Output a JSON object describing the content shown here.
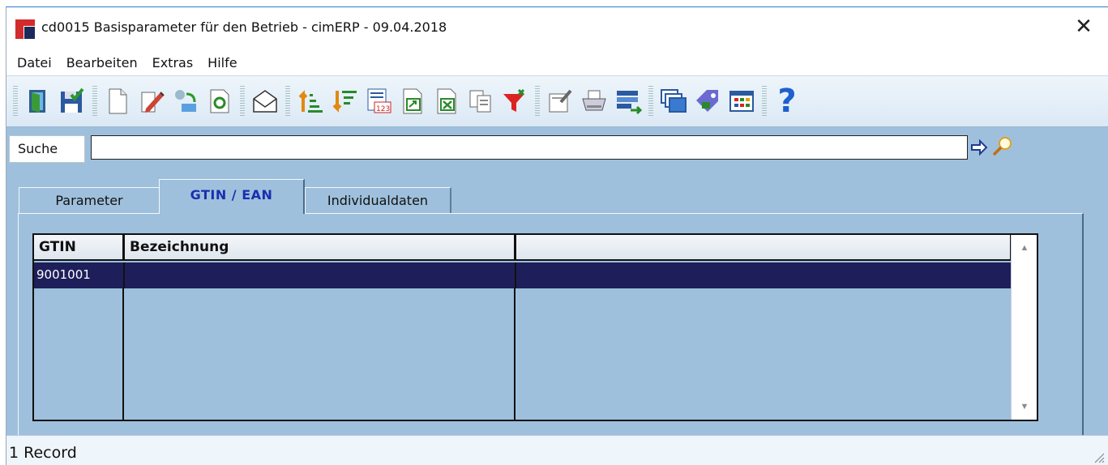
{
  "window": {
    "title": "cd0015 Basisparameter für den Betrieb - cimERP - 09.04.2018",
    "close_glyph": "✕"
  },
  "menu": {
    "items": [
      "Datei",
      "Bearbeiten",
      "Extras",
      "Hilfe"
    ]
  },
  "toolbar": {
    "icons": [
      "exit-door-icon",
      "save-icon",
      "new-document-icon",
      "edit-pencil-icon",
      "copy-transfer-icon",
      "refresh-icon",
      "envelope-icon",
      "sort-ascending-icon",
      "sort-descending-icon",
      "number-format-icon",
      "export-icon",
      "excel-export-icon",
      "duplicate-icon",
      "filter-funnel-icon",
      "properties-icon",
      "printer-icon",
      "list-transfer-icon",
      "windows-icon",
      "tag-icon",
      "table-grid-icon",
      "help-icon"
    ],
    "help_glyph": "?"
  },
  "search": {
    "label": "Suche",
    "value": ""
  },
  "tabs": [
    {
      "label": "Parameter",
      "active": false
    },
    {
      "label": "GTIN / EAN",
      "active": true
    },
    {
      "label": "Individualdaten",
      "active": false
    }
  ],
  "grid": {
    "columns": [
      "GTIN",
      "Bezeichnung",
      ""
    ],
    "rows": [
      [
        "9001001",
        "",
        ""
      ]
    ]
  },
  "status": {
    "text": "1 Record"
  },
  "colors": {
    "panel_blue": "#9ec0dc",
    "selected_row": "#1e1f5a",
    "active_tab_text": "#1a2fb0"
  }
}
